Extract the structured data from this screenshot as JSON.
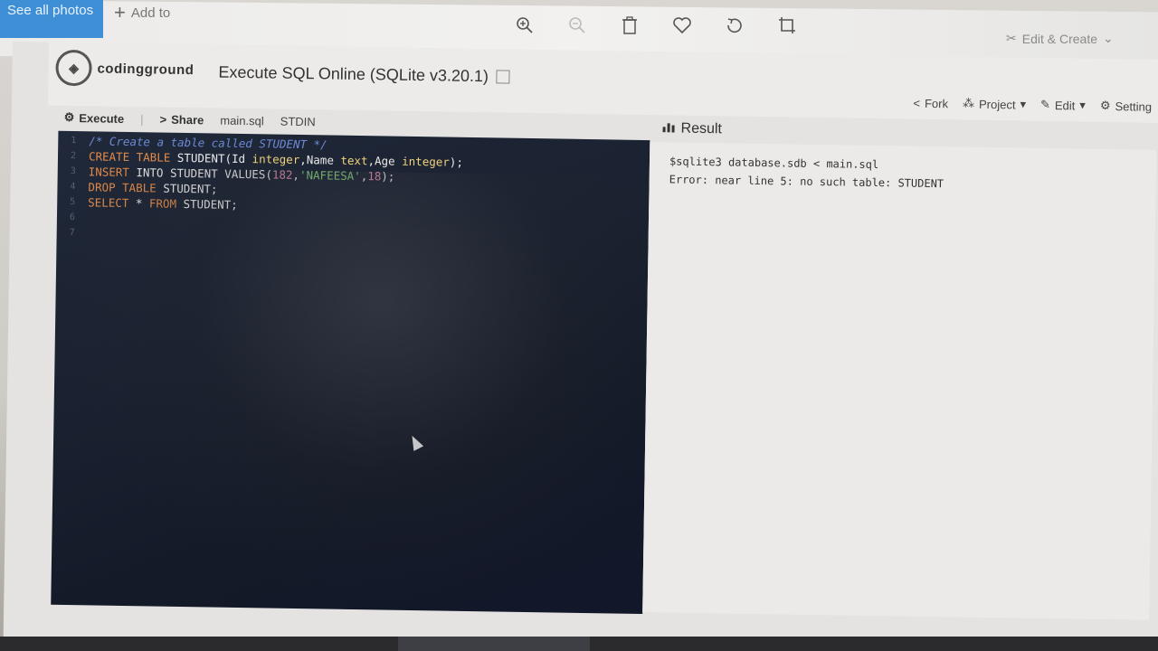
{
  "photos": {
    "see_all": "See all photos",
    "add_to": "Add to",
    "edit_create": "Edit & Create"
  },
  "site": {
    "logo": "codingground",
    "title": "Execute SQL Online (SQLite v3.20.1)"
  },
  "header_actions": {
    "fork": "Fork",
    "project": "Project",
    "edit": "Edit",
    "settings": "Setting"
  },
  "toolbar": {
    "execute": "Execute",
    "share": "Share",
    "file_tab": "main.sql",
    "stdin_tab": "STDIN"
  },
  "editor": {
    "line_numbers": [
      "1",
      "2",
      "3",
      "4",
      "5",
      "6",
      "7"
    ],
    "line1": "/* Create a table called STUDENT */",
    "line2": {
      "kw": "CREATE TABLE",
      "a": " STUDENT(Id ",
      "t1": "integer",
      "b": ",Name ",
      "t2": "text",
      "c": ",Age ",
      "t3": "integer",
      "d": ");"
    },
    "line3": {
      "kw": "INSERT",
      "a": " INTO STUDENT VALUES(",
      "n1": "182",
      "b": ",",
      "s": "'NAFEESA'",
      "c": ",",
      "n2": "18",
      "d": ");"
    },
    "line4": {
      "kw": "DROP TABLE",
      "a": " STUDENT;"
    },
    "line5": {
      "kw1": "SELECT",
      "a": " * ",
      "kw2": "FROM",
      "b": " STUDENT;"
    }
  },
  "result": {
    "title": "Result",
    "command": "$sqlite3 database.sdb < main.sql",
    "error": "Error: near line 5: no such table: STUDENT"
  }
}
